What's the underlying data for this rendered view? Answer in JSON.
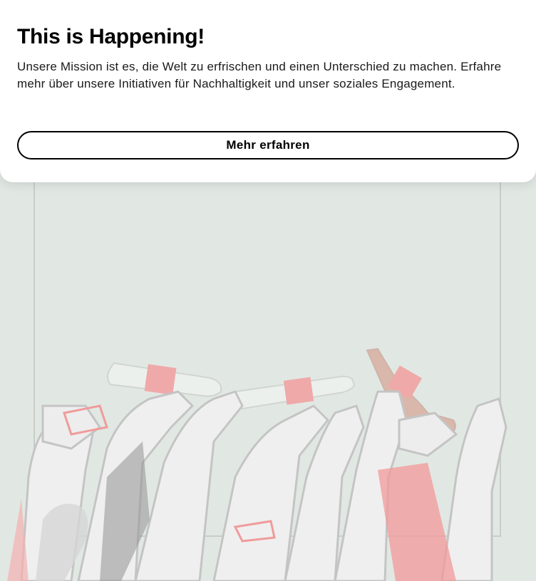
{
  "card": {
    "title": "This is Happening!",
    "body": "Unsere Mission ist es, die Welt zu erfrischen und einen Unterschied zu machen. Erfahre mehr über unsere Initiativen für Nachhaltigkeit und unser soziales Engagement.",
    "cta_label": "Mehr erfahren"
  },
  "background": {
    "illustration_subject": "raised-hands-with-coca-cola-bottles",
    "colors": {
      "backdrop": "#e1e8e3",
      "accent_red": "#f3a7a7",
      "line": "#c9c9c9"
    }
  }
}
